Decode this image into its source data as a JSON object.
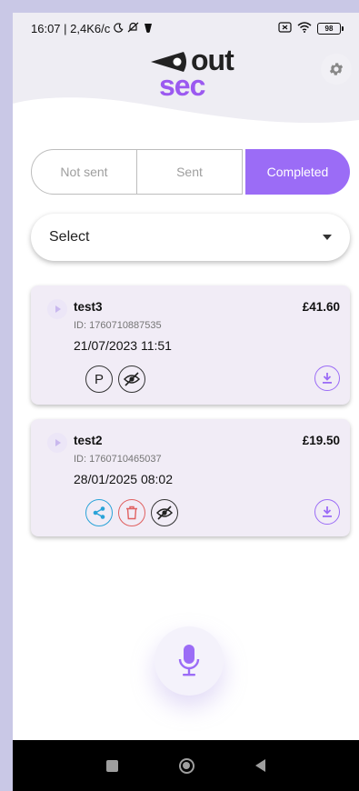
{
  "status_bar": {
    "time_info": "16:07 | 2,4K6/c",
    "battery": "98"
  },
  "logo": {
    "line1": "out",
    "line2": "sec"
  },
  "tabs": [
    {
      "label": "Not sent",
      "active": false
    },
    {
      "label": "Sent",
      "active": false
    },
    {
      "label": "Completed",
      "active": true
    }
  ],
  "select": {
    "label": "Select"
  },
  "cards": [
    {
      "title": "test3",
      "price": "£41.60",
      "id": "ID: 1760710887535",
      "date": "21/07/2023 11:51",
      "actions": [
        "p-icon",
        "hide-icon"
      ]
    },
    {
      "title": "test2",
      "price": "£19.50",
      "id": "ID: 1760710465037",
      "date": "28/01/2025 08:02",
      "actions": [
        "share-icon",
        "delete-icon",
        "hide-icon"
      ]
    }
  ],
  "p_button_label": "P",
  "colors": {
    "accent": "#9b6cf6",
    "card_bg": "#f1ecf6",
    "share": "#2aa3d8",
    "delete": "#e06060",
    "page_bg": "#c9c8e6"
  }
}
